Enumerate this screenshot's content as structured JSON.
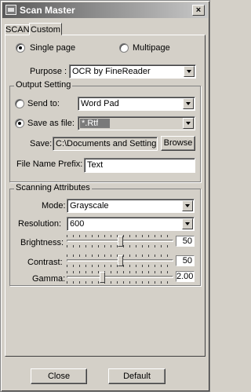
{
  "window": {
    "title": "Scan Master",
    "close_glyph": "×"
  },
  "tabs": [
    {
      "label": "SCAN"
    },
    {
      "label": "Custom"
    }
  ],
  "pages": {
    "single": "Single page",
    "multi": "Multipage",
    "selected": "single"
  },
  "purpose": {
    "label": "Purpose :",
    "value": "OCR by FineReader"
  },
  "output": {
    "group_label": "Output Setting",
    "send_to": {
      "label": "Send to:",
      "value": "Word Pad"
    },
    "save_as_file": {
      "label": "Save as file:",
      "value": "*.Rtf"
    },
    "save": {
      "label": "Save:",
      "path": "C:\\Documents and Settings\\Judi",
      "browse_label": "Browse"
    },
    "prefix": {
      "label": "File Name Prefix:",
      "value": "Text"
    },
    "selected": "save_as_file"
  },
  "scanning": {
    "group_label": "Scanning Attributes",
    "mode": {
      "label": "Mode:",
      "value": "Grayscale"
    },
    "resolution": {
      "label": "Resolution:",
      "value": "600"
    },
    "brightness": {
      "label": "Brightness:",
      "value": "50",
      "level": 0.5
    },
    "contrast": {
      "label": "Contrast:",
      "value": "50",
      "level": 0.5
    },
    "gamma": {
      "label": "Gamma:",
      "value": "2.00",
      "level": 0.33
    }
  },
  "footer": {
    "close_label": "Close",
    "default_label": "Default"
  }
}
